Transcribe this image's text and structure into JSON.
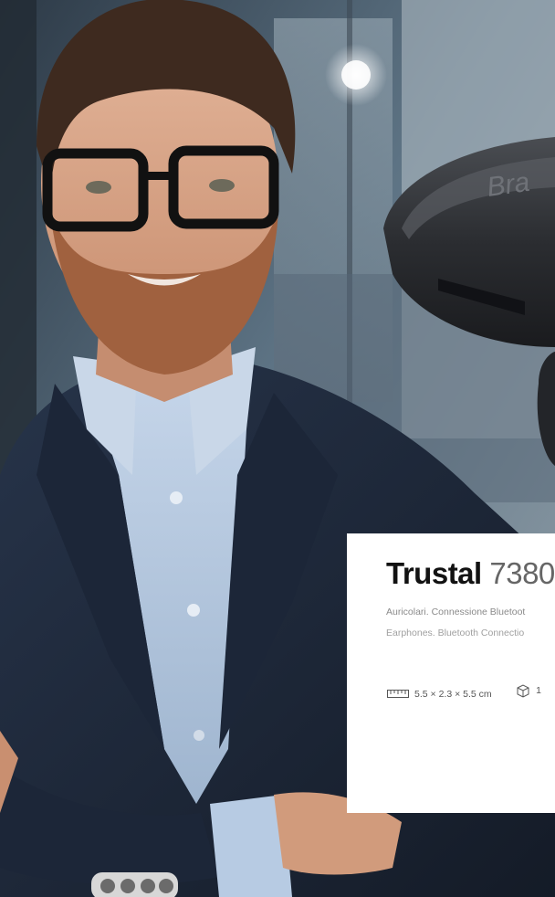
{
  "product_card": {
    "brand": "Trustal",
    "model": "7380",
    "description_it": "Auricolari. Connessione Bluetoot",
    "description_en": "Earphones. Bluetooth Connectio",
    "dimensions": "5.5 × 2.3 × 5.5 cm",
    "package_value": "1"
  },
  "earbuds_case": {
    "logo_text": "Bra"
  },
  "colors": {
    "card_bg": "#ffffff",
    "title": "#121212",
    "accent_gray": "#8a8a8a",
    "case": "#2a2c30",
    "suit": "#1e2a3d",
    "shirt": "#b7cbe3"
  },
  "icons": [
    "ruler-icon",
    "package-box-icon"
  ]
}
